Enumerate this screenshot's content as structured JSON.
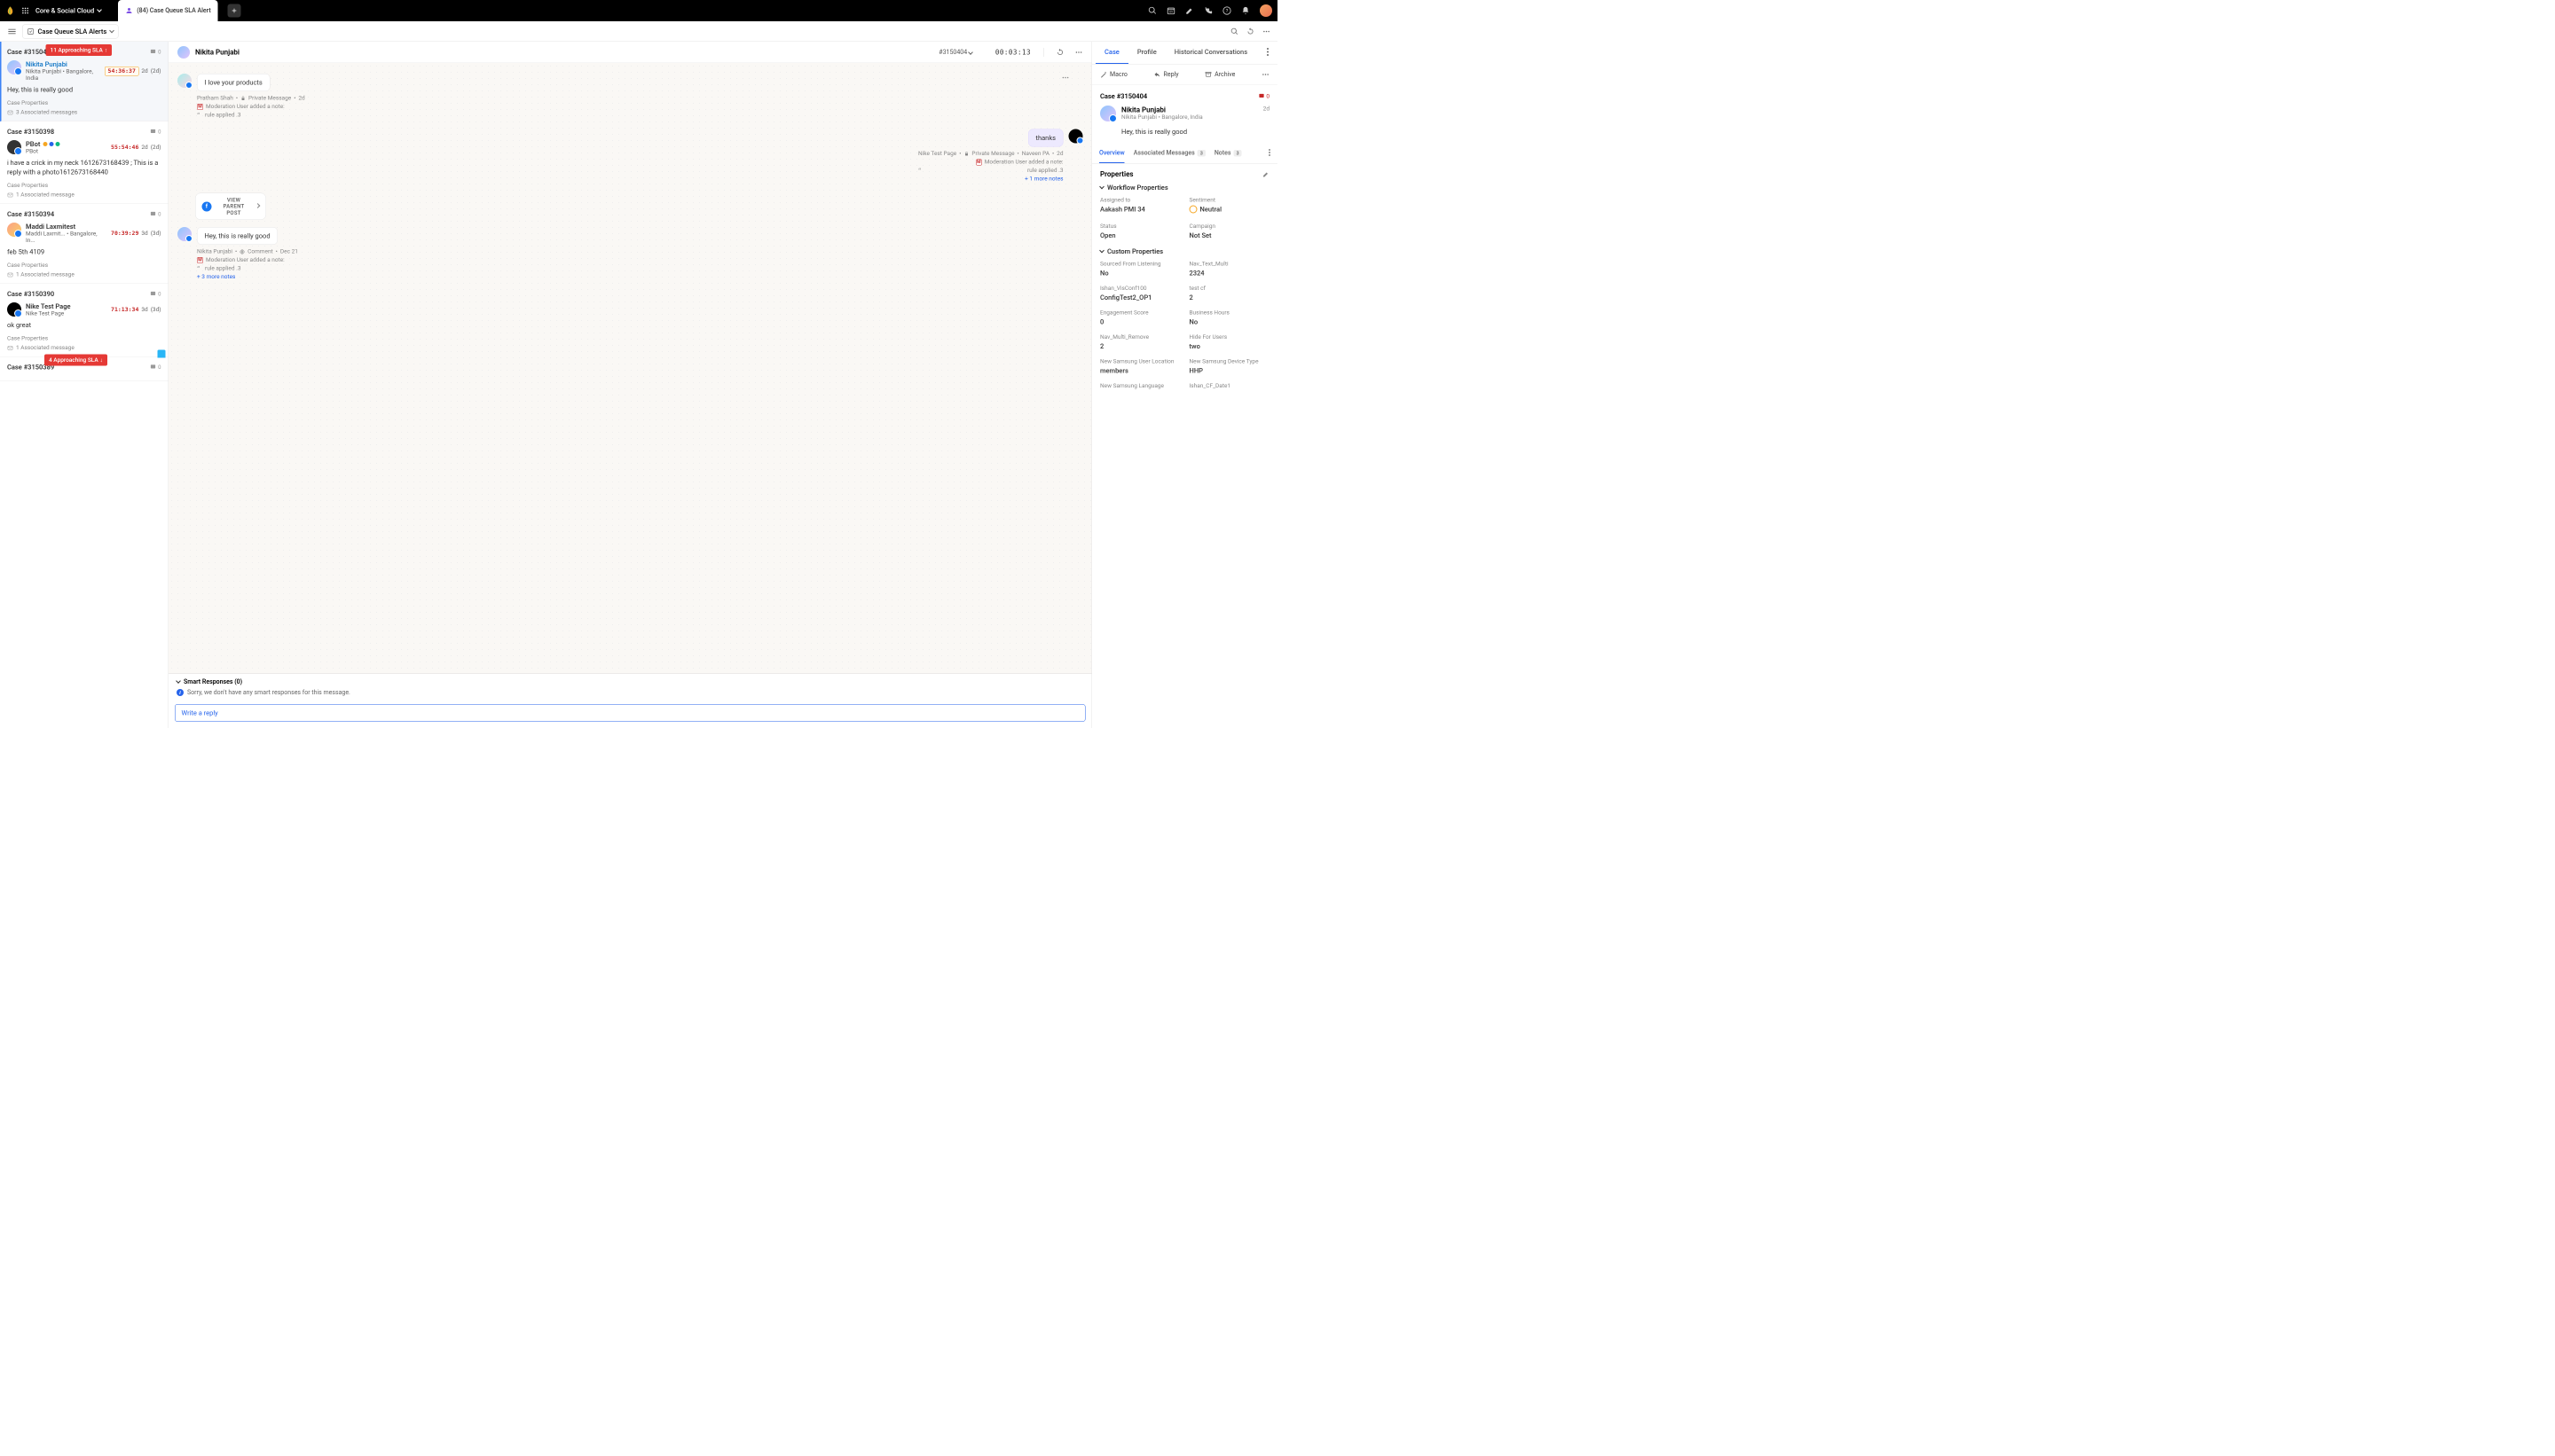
{
  "topbar": {
    "workspace": "Core & Social Cloud",
    "tab_label": "(84) Case Queue SLA Alert"
  },
  "queue_header": {
    "name": "Case Queue SLA Alerts"
  },
  "sla_pills": {
    "top": "11 Approaching SLA",
    "bottom": "4 Approaching SLA"
  },
  "cases": [
    {
      "id": "Case #3150404",
      "alert": "0",
      "name": "Nikita Punjabi",
      "subtitle": "Nikita Punjabi  •  Bangalore, India",
      "timer": "54:36:37",
      "age": "2d",
      "age_paren": "(2d)",
      "body": "Hey, this is really good",
      "props": "Case Properties",
      "assoc": "3 Associated messages"
    },
    {
      "id": "Case #3150398",
      "alert": "0",
      "name": "PBot",
      "subtitle": "PBot",
      "timer": "55:54:46",
      "age": "2d",
      "age_paren": "(2d)",
      "body": "i have a crick in my neck 1612673168439 ; This is a reply with a photo1612673168440",
      "props": "Case Properties",
      "assoc": "1 Associated message"
    },
    {
      "id": "Case #3150394",
      "alert": "0",
      "name": "Maddi Laxmitest",
      "subtitle": "Maddi Laxmit...  •  Bangalore, In...",
      "timer": "70:39:29",
      "age": "3d",
      "age_paren": "(3d)",
      "body": "feb 5th 4109",
      "props": "Case Properties",
      "assoc": "1 Associated message"
    },
    {
      "id": "Case #3150390",
      "alert": "0",
      "name": "Nike Test Page",
      "subtitle": "Nike Test Page",
      "timer": "71:13:34",
      "age": "3d",
      "age_paren": "(3d)",
      "body": "ok great",
      "props": "Case Properties",
      "assoc": "1 Associated message"
    },
    {
      "id": "Case #3150389",
      "alert": "0"
    }
  ],
  "center": {
    "name": "Nikita Punjabi",
    "case_id": "#3150404",
    "elapsed": "00:03:13",
    "view_parent": "VIEW PARENT POST",
    "messages": [
      {
        "bubble": "I love your products",
        "author": "Pratham Shah",
        "channel": "Private Message",
        "age": "2d",
        "note": "Moderation User added a note:",
        "quote": "rule applied .3"
      },
      {
        "bubble": "thanks",
        "page": "Nike Test Page",
        "channel": "Private Message",
        "author": "Naveen PA",
        "age": "2d",
        "note": "Moderation User added a note:",
        "quote": "rule applied .3",
        "more": "+ 1 more notes"
      },
      {
        "bubble": "Hey, this is really good",
        "author": "Nikita Punjabi",
        "channel": "Comment",
        "age": "Dec 21",
        "note": "Moderation User added a note:",
        "quote": "rule applied .3",
        "more": "+ 3 more notes"
      }
    ],
    "smart_header": "Smart Responses (0)",
    "smart_body": "Sorry, we don't have any smart responses for this message.",
    "reply_placeholder": "Write a reply"
  },
  "right": {
    "tabs": {
      "case": "Case",
      "profile": "Profile",
      "history": "Historical Conversations"
    },
    "actions": {
      "macro": "Macro",
      "reply": "Reply",
      "archive": "Archive"
    },
    "case_id": "Case #3150404",
    "alert": "0",
    "name": "Nikita Punjabi",
    "subtitle": "Nikita Punjabi  •  Bangalore, India",
    "age": "2d",
    "body": "Hey, this is really good",
    "subtabs": {
      "overview": "Overview",
      "assoc": "Associated Messages",
      "assoc_count": "3",
      "notes": "Notes",
      "notes_count": "3"
    },
    "section_title": "Properties",
    "group1_title": "Workflow Properties",
    "group2_title": "Custom Properties",
    "workflow": {
      "assigned_label": "Assigned to",
      "assigned_value": "Aakash PMI 34",
      "sentiment_label": "Sentiment",
      "sentiment_value": "Neutral",
      "status_label": "Status",
      "status_value": "Open",
      "campaign_label": "Campaign",
      "campaign_value": "Not Set"
    },
    "custom": [
      {
        "label": "Sourced From Listening",
        "value": "No"
      },
      {
        "label": "Nav_Text_Multi",
        "value": "2324"
      },
      {
        "label": "Ishan_VisConf100",
        "value": "ConfigTest2_OP1"
      },
      {
        "label": "test cf",
        "value": "2"
      },
      {
        "label": "Engagement Score",
        "value": "0"
      },
      {
        "label": "Business Hours",
        "value": "No"
      },
      {
        "label": "Nav_Multi_Remove",
        "value": "2"
      },
      {
        "label": "Hide For Users",
        "value": "two"
      },
      {
        "label": "New Samsung User Location",
        "value": "members"
      },
      {
        "label": "New Samsung Device Type",
        "value": "HHP"
      },
      {
        "label": "New Samsung Language",
        "value": ""
      },
      {
        "label": "Ishan_CF_Date1",
        "value": ""
      }
    ]
  }
}
